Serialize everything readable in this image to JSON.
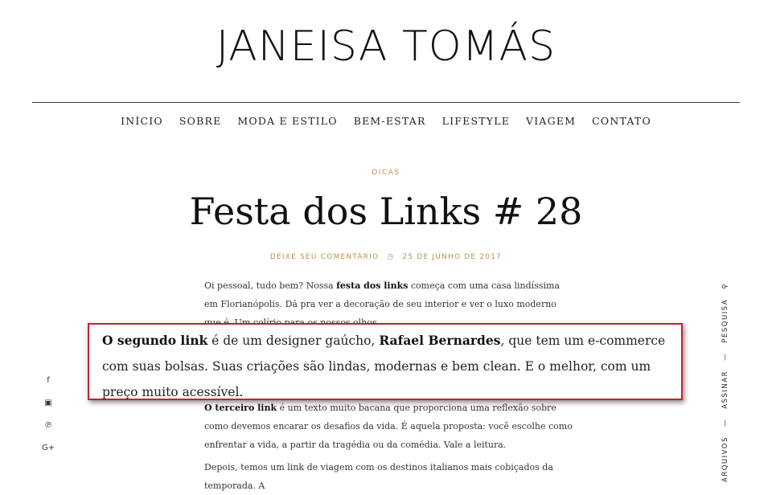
{
  "site": {
    "brand": "JANEISA TOMÁS"
  },
  "nav": {
    "items": [
      "INÍCIO",
      "SOBRE",
      "MODA E ESTILO",
      "BEM-ESTAR",
      "LIFESTYLE",
      "VIAGEM",
      "CONTATO"
    ]
  },
  "post": {
    "category": "DICAS",
    "title": "Festa dos Links # 28",
    "comment_link": "DEIXE SEU COMENTÁRIO",
    "meta_separator_icon": "clock-icon",
    "date": "25 DE JUNHO DE 2017"
  },
  "article": {
    "p1_a": "Oi pessoal, tudo bem? Nossa ",
    "p1_b": "festa dos links",
    "p1_c": " começa com uma casa lindíssima em Florianópolis. Dá pra ver a decoração de seu interior e ver o luxo moderno que é. Um colírio para os nossos olhos.",
    "p2_a": "O terceiro link",
    "p2_b": " é um texto muito bacana que proporciona uma reflexão sobre como devemos encarar os desafios da vida. É aquela proposta: você escolhe como enfrentar a vida, a partir da tragédia ou da comédia. Vale a leitura.",
    "p3_a": "Depois, temos um link de viagem com os destinos italianos mais cobiçados da temporada. A"
  },
  "highlight": {
    "part1": "O segundo link",
    "part2": " é de um designer gaúcho, ",
    "part3": "Rafael Bernardes",
    "part4": ", que tem um e-commerce com suas bolsas. Suas criações são lindas, modernas e bem clean. E o melhor, com um preço muito acessível."
  },
  "social": {
    "facebook": "f",
    "instagram": "▣",
    "pinterest": "℗",
    "googleplus": "G+"
  },
  "sidebar": {
    "archives": "ARQUIVOS",
    "separator": "—",
    "subscribe": "ASSINAR",
    "search": "PESQUISA",
    "search_icon": "⚲"
  },
  "colors": {
    "accent": "#b8924a",
    "highlight_border": "#c8202a"
  }
}
